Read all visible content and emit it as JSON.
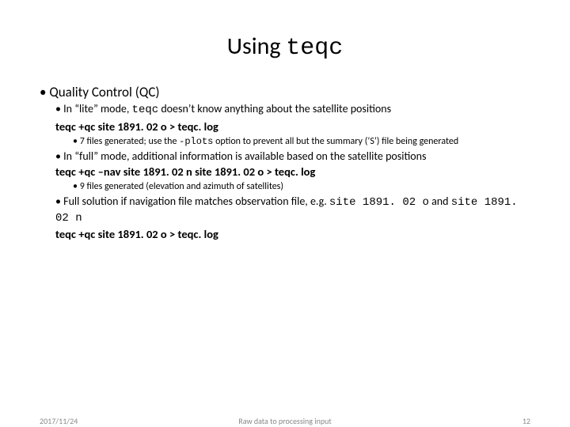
{
  "title": {
    "prefix": "Using ",
    "cmd": "teqc"
  },
  "main_bullet": "Quality Control (QC)",
  "lite": {
    "line_pre": "In “lite” mode, ",
    "line_cmd": "teqc",
    "line_post": " doesn’t know anything about the satellite positions",
    "command": "teqc +qc site 1891. 02 o > teqc. log",
    "note_pre": "7 files generated; use the ",
    "note_opt": "-plots",
    "note_post": " option to prevent all but the summary (‘S’) file being generated"
  },
  "full": {
    "line": "In “full” mode, additional information is available based on the satellite positions",
    "command": "teqc +qc –nav site 1891. 02 n site 1891. 02 o > teqc. log",
    "note": "9 files generated (elevation and azimuth of satellites)"
  },
  "fullsol": {
    "line_pre": "Full solution if navigation file matches observation file, e.g. ",
    "file1": "site 1891. 02 o",
    "mid": " and ",
    "file2": "site 1891. 02 n",
    "command": "teqc +qc site 1891. 02 o > teqc. log"
  },
  "footer": {
    "date": "2017/11/24",
    "mid": "Raw data to processing input",
    "page": "12"
  }
}
